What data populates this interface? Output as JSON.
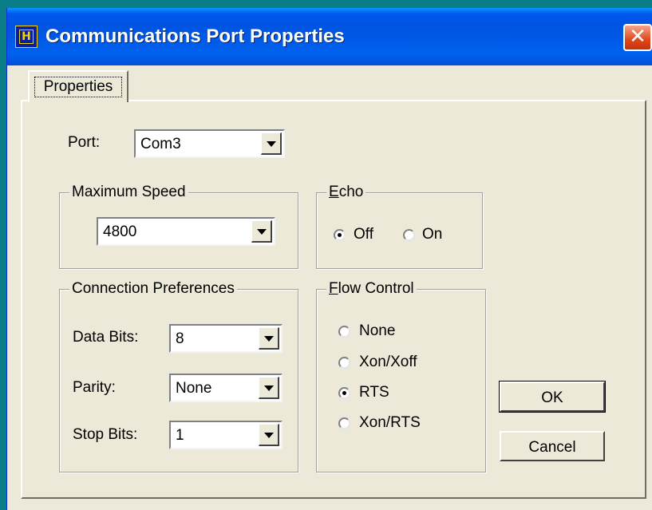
{
  "window": {
    "title": "Communications Port Properties",
    "icon_glyph": "H",
    "close_glyph": "✕"
  },
  "tab": {
    "label": "Properties"
  },
  "port": {
    "label": "Port:",
    "value": "Com3"
  },
  "max_speed": {
    "legend": "Maximum Speed",
    "value": "4800"
  },
  "echo": {
    "legend_mnemonic": "E",
    "legend_rest": "cho",
    "options": [
      {
        "label": "Off",
        "selected": true
      },
      {
        "label": "On",
        "selected": false
      }
    ]
  },
  "connection": {
    "legend": "Connection Preferences",
    "data_bits": {
      "label": "Data Bits:",
      "value": "8"
    },
    "parity": {
      "label": "Parity:",
      "value": "None"
    },
    "stop_bits": {
      "label": "Stop Bits:",
      "value": "1"
    }
  },
  "flow_control": {
    "legend_mnemonic": "F",
    "legend_rest": "low Control",
    "options": [
      {
        "label": "None",
        "selected": false
      },
      {
        "label": "Xon/Xoff",
        "selected": false
      },
      {
        "label": "RTS",
        "selected": true
      },
      {
        "label": "Xon/RTS",
        "selected": false
      }
    ]
  },
  "buttons": {
    "ok": "OK",
    "cancel": "Cancel"
  },
  "colors": {
    "desktop": "#0a7d86",
    "title_bar": "#0058ee",
    "face": "#ece9d8",
    "close": "#e0461b"
  }
}
